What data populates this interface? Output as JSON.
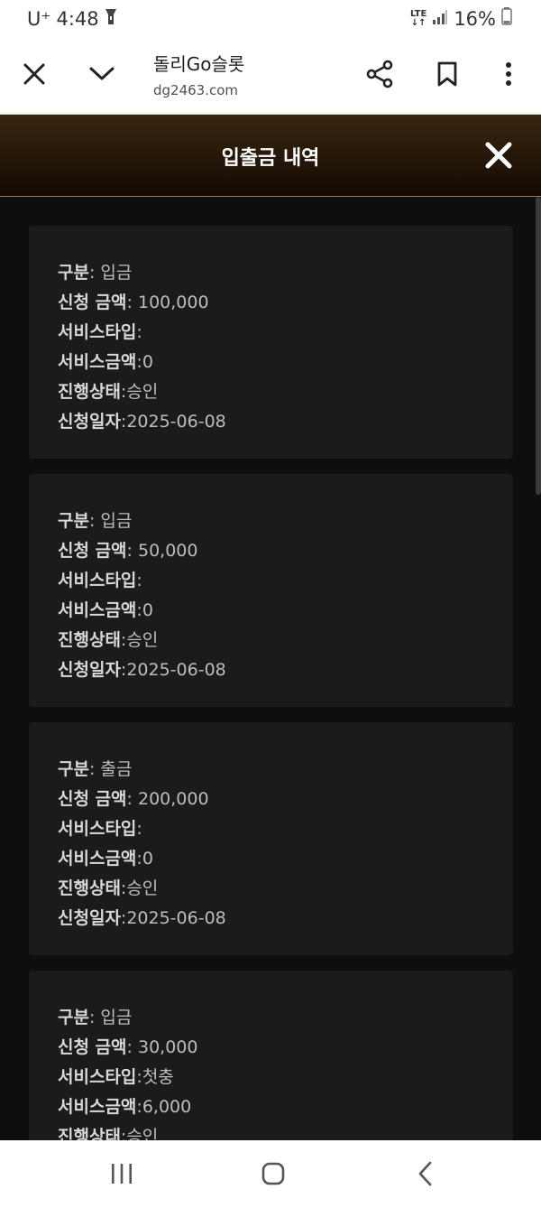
{
  "status_bar": {
    "carrier": "U⁺",
    "time": "4:48",
    "network": "LTE",
    "battery": "16%"
  },
  "browser": {
    "site_title": "돌리Go슬롯",
    "site_url": "dg2463.com"
  },
  "modal": {
    "title": "입출금 내역"
  },
  "labels": {
    "type": "구분",
    "amount": "신청 금액",
    "service_type": "서비스타입",
    "service_amount": "서비스금액",
    "status": "진행상태",
    "date": "신청일자"
  },
  "records": [
    {
      "type": " 입금",
      "amount": " 100,000",
      "service_type": "",
      "service_amount": "0",
      "status": "승인",
      "date": "2025-06-08"
    },
    {
      "type": " 입금",
      "amount": " 50,000",
      "service_type": "",
      "service_amount": "0",
      "status": "승인",
      "date": "2025-06-08"
    },
    {
      "type": " 출금",
      "amount": " 200,000",
      "service_type": "",
      "service_amount": "0",
      "status": "승인",
      "date": "2025-06-08"
    },
    {
      "type": " 입금",
      "amount": " 30,000",
      "service_type": "첫충",
      "service_amount": "6,000",
      "status": "승인",
      "date": ""
    }
  ],
  "icons": {
    "close": "close-icon",
    "chevron": "chevron-down-icon",
    "share": "share-icon",
    "bookmark": "bookmark-icon",
    "more": "more-vert-icon",
    "recent_apps": "recent-apps-icon",
    "home": "home-icon",
    "back": "back-icon"
  }
}
